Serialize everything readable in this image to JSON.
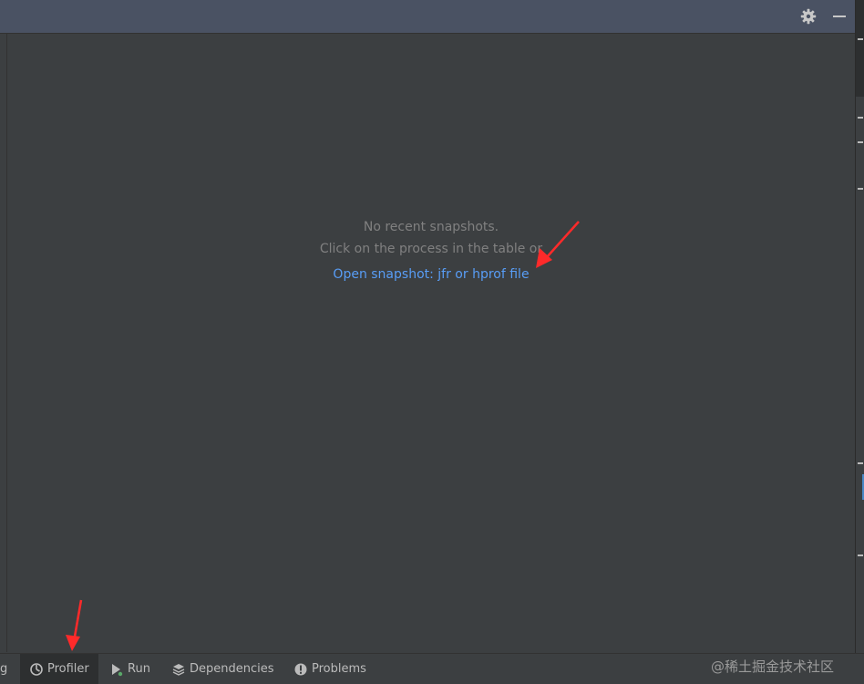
{
  "empty_state": {
    "line1": "No recent snapshots.",
    "line2": "Click on the process in the table or",
    "link": "Open snapshot: jfr or hprof file"
  },
  "bottom_tabs": [
    {
      "label": "g",
      "icon": "partial-tab"
    },
    {
      "label": "Profiler",
      "icon": "profiler-icon",
      "active": true
    },
    {
      "label": "Run",
      "icon": "run-icon"
    },
    {
      "label": "Dependencies",
      "icon": "dependencies-icon"
    },
    {
      "label": "Problems",
      "icon": "problems-icon"
    }
  ],
  "toolbar_icons": [
    "gear-icon",
    "minimize-icon"
  ],
  "watermark": "@稀土掘金技术社区",
  "colors": {
    "background": "#3c3f41",
    "header": "#4a5263",
    "link": "#589df6",
    "muted_text": "#808080",
    "annotation_arrow": "#ff2a2a",
    "run_accent": "#59a869"
  }
}
